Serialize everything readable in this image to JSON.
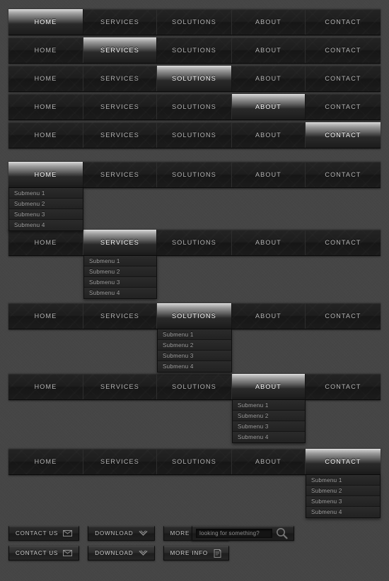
{
  "theme": {
    "page_background": "#454545",
    "bar_background": "#1d1d1d",
    "active_highlight": "#d6d6d6",
    "text_color": "#b9b9b9",
    "active_text_color": "#ffffff",
    "submenu_background": "#232323"
  },
  "nav": {
    "items": [
      {
        "label": "HOME"
      },
      {
        "label": "SERVICES"
      },
      {
        "label": "SOLUTIONS"
      },
      {
        "label": "ABOUT"
      },
      {
        "label": "CONTACT"
      }
    ]
  },
  "submenu": {
    "items": [
      {
        "label": "Submenu 1"
      },
      {
        "label": "Submenu 2"
      },
      {
        "label": "Submenu 3"
      },
      {
        "label": "Submenu 4"
      }
    ]
  },
  "rows": [
    {
      "active_index": 0,
      "has_submenu": false
    },
    {
      "active_index": 1,
      "has_submenu": false
    },
    {
      "active_index": 2,
      "has_submenu": false
    },
    {
      "active_index": 3,
      "has_submenu": false
    },
    {
      "active_index": 4,
      "has_submenu": false
    },
    {
      "active_index": 0,
      "has_submenu": true
    },
    {
      "active_index": 1,
      "has_submenu": true
    },
    {
      "active_index": 2,
      "has_submenu": true
    },
    {
      "active_index": 3,
      "has_submenu": true
    },
    {
      "active_index": 4,
      "has_submenu": true
    }
  ],
  "buttons": {
    "row_one": [
      {
        "label": "CONTACT US",
        "icon": "envelope-icon"
      },
      {
        "label": "DOWNLOAD",
        "icon": "chevron-down-icon"
      },
      {
        "label": "MORE INFO",
        "icon": "book-icon"
      }
    ],
    "row_two": [
      {
        "label": "CONTACT US",
        "icon": "envelope-icon"
      },
      {
        "label": "DOWNLOAD",
        "icon": "chevron-down-icon"
      },
      {
        "label": "MORE INFO",
        "icon": "book-icon"
      }
    ]
  },
  "search": {
    "placeholder": "looking for something?",
    "value": "",
    "button_icon": "magnifier-icon"
  }
}
